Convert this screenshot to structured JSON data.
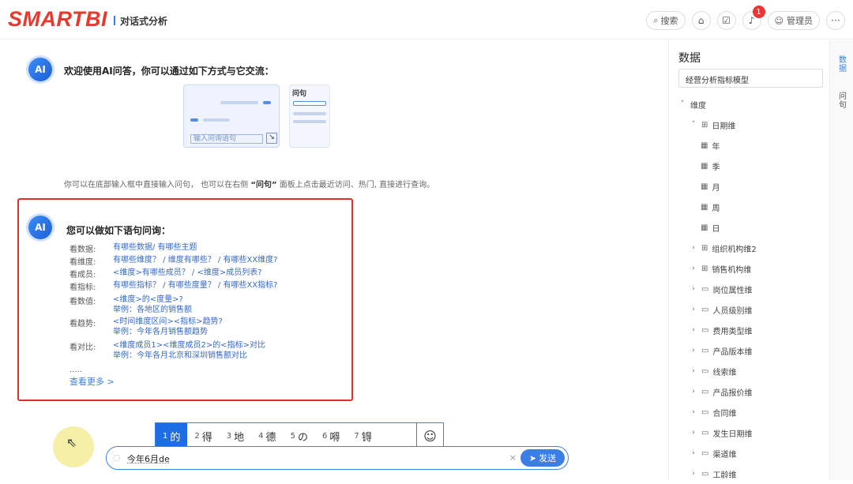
{
  "header": {
    "logo": "SMARTBI",
    "app_title": "对话式分析",
    "search_label": "搜索",
    "notification_count": "1",
    "user_name": "管理员",
    "more_label": "···"
  },
  "chat": {
    "avatar_label": "AI",
    "welcome": "欢迎使用AI问答，你可以通过如下方式与它交流：",
    "illus_ask_label": "问句",
    "illus_input_placeholder": "输入问询语句",
    "tip_prefix": "你可以在底部输入框中直接输入问句，  也可以在右侧",
    "tip_bold": "“问句”",
    "tip_suffix": "面板上点击最近访问、热门, 直接进行查询。",
    "suggest_title": "您可以做如下语句问询：",
    "suggestions": [
      {
        "key": "看数据:",
        "value": "有哪些数据/ 有哪些主题",
        "example": ""
      },
      {
        "key": "看维度:",
        "value": "有哪些维度？ / 维度有哪些？ / 有哪些XX维度?",
        "example": ""
      },
      {
        "key": "看成员:",
        "value": "<维度>有哪些成员？ / <维度>成员列表?",
        "example": ""
      },
      {
        "key": "看指标:",
        "value": "有哪些指标？ / 有哪些度量？ / 有哪些XX指标?",
        "example": ""
      },
      {
        "key": "看数值:",
        "value": "<维度>的<度量>?",
        "example": "举例：各地区的销售额"
      },
      {
        "key": "看趋势:",
        "value": "<时间维度区间><指标>趋势?",
        "example": "举例：今年各月销售额趋势"
      },
      {
        "key": "看对比:",
        "value": "<维度成员1><维度成员2>的<指标>对比",
        "example": "举例：今年各月北京和深圳销售额对比"
      }
    ],
    "ellipsis": ".....",
    "see_more": "查看更多 >"
  },
  "ime": {
    "candidates": [
      {
        "num": "1",
        "text": "的"
      },
      {
        "num": "2",
        "text": "得"
      },
      {
        "num": "3",
        "text": "地"
      },
      {
        "num": "4",
        "text": "德"
      },
      {
        "num": "5",
        "text": "の"
      },
      {
        "num": "6",
        "text": "嘚"
      },
      {
        "num": "7",
        "text": "锝"
      }
    ],
    "emoji": "☺"
  },
  "input": {
    "value": "今年6月de",
    "clear": "×",
    "send_label": "发送"
  },
  "data_panel": {
    "title": "数据",
    "model": "经营分析指标模型",
    "tree": [
      {
        "level": 0,
        "arrow": "˅",
        "icon": "",
        "label": "维度"
      },
      {
        "level": 1,
        "arrow": "˅",
        "icon": "⊞",
        "label": "日期维"
      },
      {
        "level": 2,
        "arrow": "",
        "icon": "▦",
        "label": "年"
      },
      {
        "level": 2,
        "arrow": "",
        "icon": "▦",
        "label": "季"
      },
      {
        "level": 2,
        "arrow": "",
        "icon": "▦",
        "label": "月"
      },
      {
        "level": 2,
        "arrow": "",
        "icon": "▦",
        "label": "周"
      },
      {
        "level": 2,
        "arrow": "",
        "icon": "▦",
        "label": "日"
      },
      {
        "level": 1,
        "arrow": "›",
        "icon": "⊞",
        "label": "组织机构维2"
      },
      {
        "level": 1,
        "arrow": "›",
        "icon": "⊞",
        "label": "销售机构维"
      },
      {
        "level": 1,
        "arrow": "›",
        "icon": "▭",
        "label": "岗位属性维"
      },
      {
        "level": 1,
        "arrow": "›",
        "icon": "▭",
        "label": "人员级别维"
      },
      {
        "level": 1,
        "arrow": "›",
        "icon": "▭",
        "label": "费用类型维"
      },
      {
        "level": 1,
        "arrow": "›",
        "icon": "▭",
        "label": "产品版本维"
      },
      {
        "level": 1,
        "arrow": "›",
        "icon": "▭",
        "label": "线索维"
      },
      {
        "level": 1,
        "arrow": "›",
        "icon": "▭",
        "label": "产品报价维"
      },
      {
        "level": 1,
        "arrow": "›",
        "icon": "▭",
        "label": "合同维"
      },
      {
        "level": 1,
        "arrow": "›",
        "icon": "▭",
        "label": "发生日期维"
      },
      {
        "level": 1,
        "arrow": "›",
        "icon": "▭",
        "label": "渠道维"
      },
      {
        "level": 1,
        "arrow": "›",
        "icon": "▭",
        "label": "工龄维"
      }
    ]
  },
  "side_tabs": {
    "data": "数据",
    "question": "问句"
  },
  "colors": {
    "brand": "#e83a2c",
    "accent": "#3b7fe5",
    "highlight_border": "#e0302a"
  }
}
